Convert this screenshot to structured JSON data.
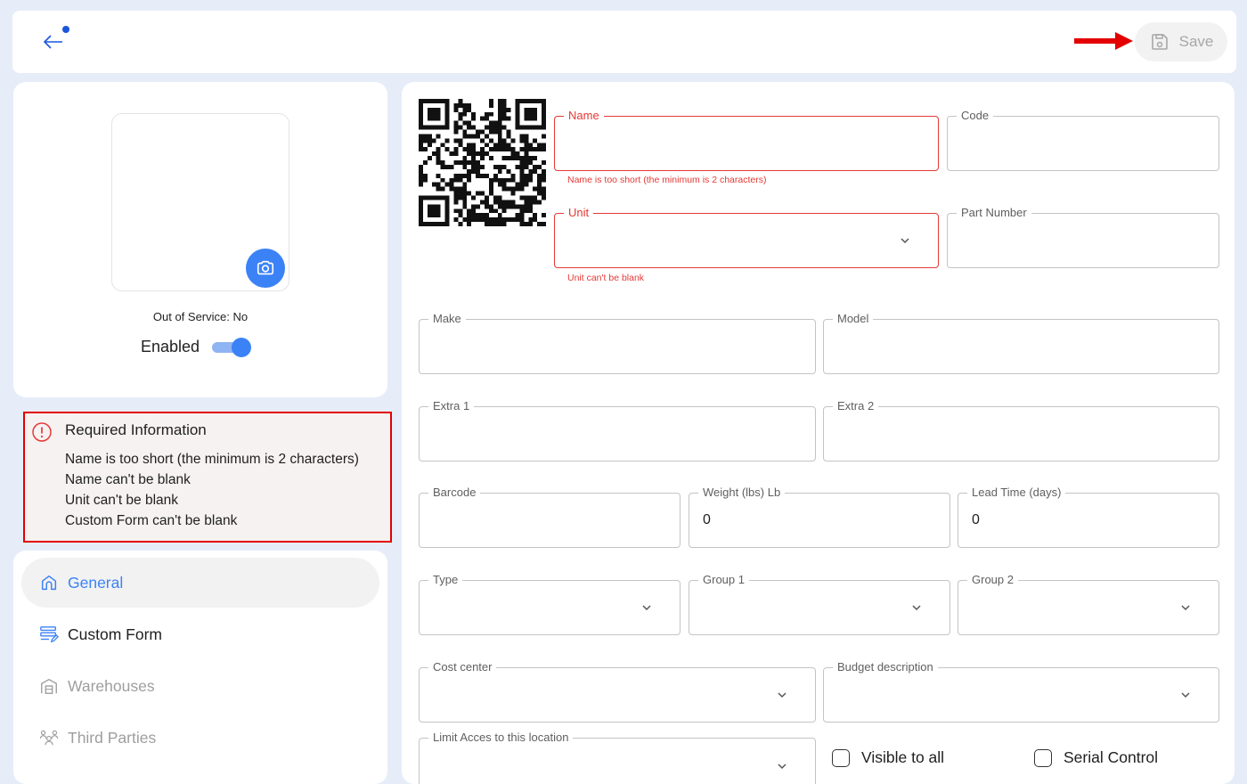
{
  "header": {
    "save_label": "Save"
  },
  "side": {
    "out_of_service": "Out of Service: No",
    "enabled_label": "Enabled",
    "enabled_on": true
  },
  "required": {
    "title": "Required Information",
    "items": [
      "Name is too short (the minimum is 2 characters)",
      "Name can't be blank",
      "Unit can't be blank",
      "Custom Form can't be blank"
    ]
  },
  "nav": {
    "items": [
      {
        "label": "General",
        "icon": "home-icon",
        "state": "active"
      },
      {
        "label": "Custom Form",
        "icon": "form-edit-icon",
        "state": "normal"
      },
      {
        "label": "Warehouses",
        "icon": "warehouse-icon",
        "state": "disabled"
      },
      {
        "label": "Third Parties",
        "icon": "people-icon",
        "state": "disabled"
      }
    ]
  },
  "form": {
    "name": {
      "label": "Name",
      "value": "",
      "error": "Name is too short (the minimum is 2 characters)"
    },
    "code": {
      "label": "Code",
      "value": ""
    },
    "unit": {
      "label": "Unit",
      "value": "",
      "error": "Unit can't be blank"
    },
    "part_number": {
      "label": "Part Number",
      "value": ""
    },
    "make": {
      "label": "Make",
      "value": ""
    },
    "model": {
      "label": "Model",
      "value": ""
    },
    "extra1": {
      "label": "Extra 1",
      "value": ""
    },
    "extra2": {
      "label": "Extra 2",
      "value": ""
    },
    "barcode": {
      "label": "Barcode",
      "value": ""
    },
    "weight": {
      "label": "Weight (lbs) Lb",
      "value": "0"
    },
    "lead_time": {
      "label": "Lead Time (days)",
      "value": "0"
    },
    "type": {
      "label": "Type",
      "value": ""
    },
    "group1": {
      "label": "Group 1",
      "value": ""
    },
    "group2": {
      "label": "Group 2",
      "value": ""
    },
    "cost_center": {
      "label": "Cost center",
      "value": ""
    },
    "budget_description": {
      "label": "Budget description",
      "value": ""
    },
    "limit_access": {
      "label": "Limit Acces to this location",
      "value": ""
    },
    "visible_to_all": {
      "label": "Visible to all",
      "checked": false
    },
    "serial_control": {
      "label": "Serial Control",
      "checked": false
    }
  },
  "colors": {
    "accent": "#3b82f6",
    "error": "#e53935",
    "highlight_border": "#e30000",
    "annotation_arrow": "#e30000"
  }
}
